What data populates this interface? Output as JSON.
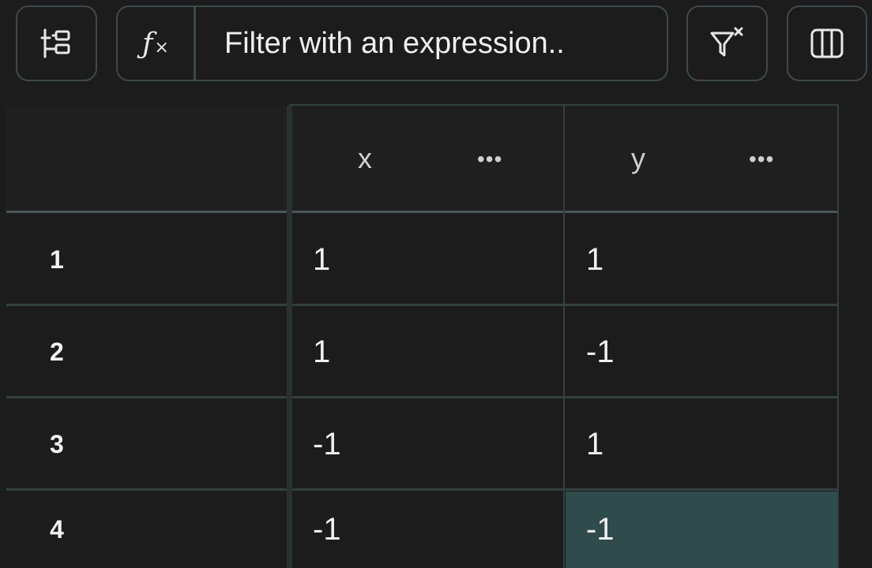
{
  "toolbar": {
    "tree_icon": "tree-structure-icon",
    "fx_label": "ƒ",
    "fx_sub": "×",
    "expression_placeholder": "Filter with an expression..",
    "filter_clear_icon": "filter-clear-icon",
    "columns_icon": "columns-icon"
  },
  "table": {
    "columns": [
      {
        "name": "x",
        "menu": "•••"
      },
      {
        "name": "y",
        "menu": "•••"
      }
    ],
    "rows": [
      {
        "index": "1",
        "x": "1",
        "y": "1"
      },
      {
        "index": "2",
        "x": "1",
        "y": "-1"
      },
      {
        "index": "3",
        "x": "-1",
        "y": "1"
      },
      {
        "index": "4",
        "x": "-1",
        "y": "-1"
      }
    ],
    "selected_cell": {
      "row": 4,
      "column": "y"
    },
    "colors": {
      "background": "#1c1c1d",
      "grid_line": "#33403f",
      "selected": "#2f4b4b"
    }
  }
}
